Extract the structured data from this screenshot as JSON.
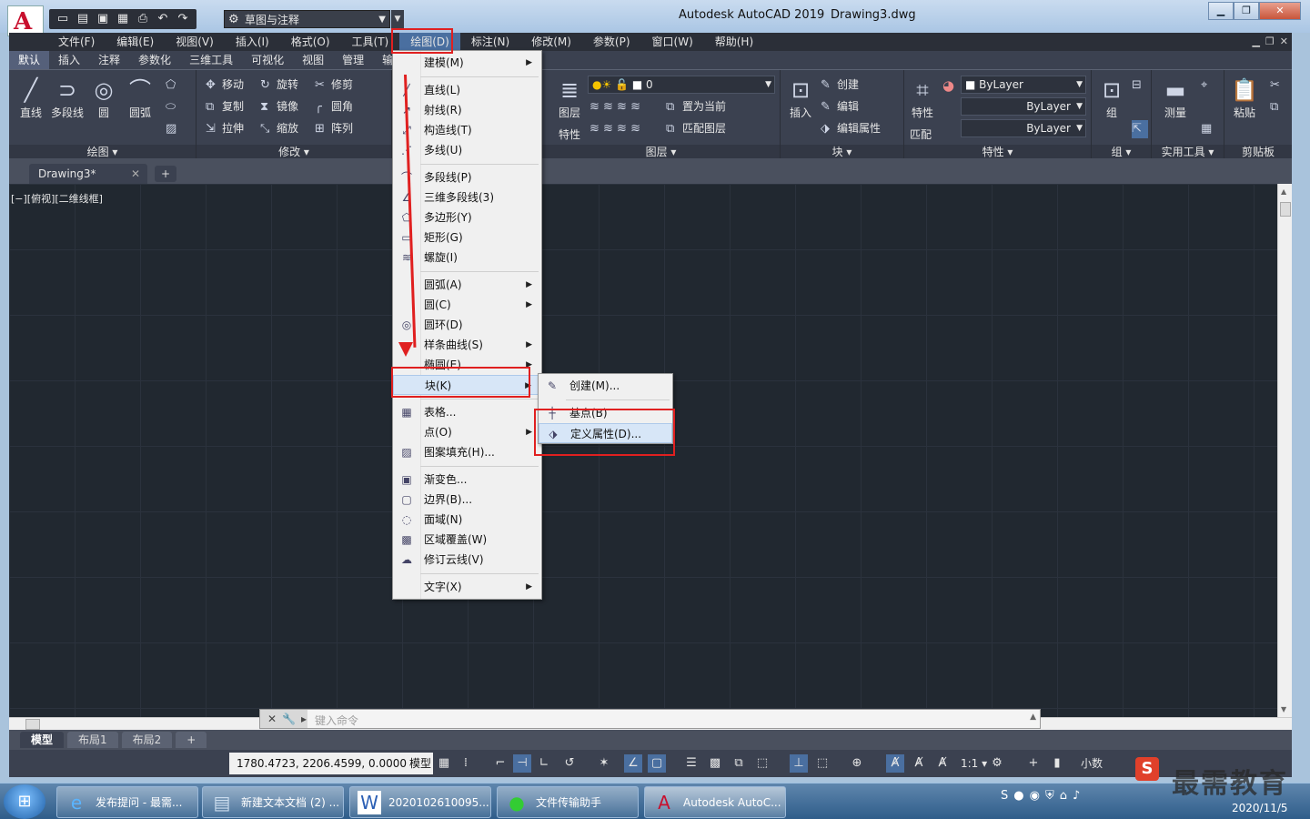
{
  "titlebar": {
    "app_title": "Autodesk AutoCAD 2019",
    "doc_title": "Drawing3.dwg",
    "workspace": "草图与注释",
    "logo_letter": "A"
  },
  "menubar": {
    "items": [
      "文件(F)",
      "编辑(E)",
      "视图(V)",
      "插入(I)",
      "格式(O)",
      "工具(T)",
      "绘图(D)",
      "标注(N)",
      "修改(M)",
      "参数(P)",
      "窗口(W)",
      "帮助(H)"
    ],
    "active_index": 6
  },
  "ribbon_tabs": [
    "默认",
    "插入",
    "注释",
    "参数化",
    "三维工具",
    "可视化",
    "视图",
    "管理",
    "输"
  ],
  "ribbon": {
    "draw_panel": {
      "title": "绘图 ▾",
      "line": "直线",
      "polyline": "多段线",
      "circle": "圆",
      "arc": "圆弧"
    },
    "modify_panel": {
      "title": "修改 ▾",
      "move": "移动",
      "rotate": "旋转",
      "trim": "修剪",
      "copy": "复制",
      "mirror": "镜像",
      "fillet": "圆角",
      "stretch": "拉伸",
      "scale": "缩放",
      "array": "阵列"
    },
    "layers_panel": {
      "title": "图层 ▾",
      "props_top": "图层",
      "props_bottom": "特性",
      "layer_value": "0",
      "set_current": "置为当前",
      "match_layer": "匹配图层"
    },
    "block_panel": {
      "title": "块 ▾",
      "insert": "插入",
      "create": "创建",
      "edit": "编辑",
      "edit_attr": "编辑属性"
    },
    "properties_panel": {
      "title": "特性 ▾",
      "match_top": "特性",
      "match_bottom": "匹配",
      "color": "ByLayer",
      "linetype": "ByLayer",
      "lineweight": "ByLayer"
    },
    "groups_panel": {
      "title": "组 ▾",
      "group": "组"
    },
    "utilities_panel": {
      "title": "实用工具 ▾",
      "measure": "测量"
    },
    "clipboard_panel": {
      "title": "剪贴板",
      "paste": "粘贴"
    }
  },
  "doc_tab": "Drawing3*",
  "viewport_label": "[−][俯视][二维线框]",
  "draw_menu": {
    "items": [
      {
        "label": "建模(M)",
        "icon": "",
        "sub": true
      },
      {
        "label": "直线(L)",
        "icon": "╱",
        "sub": false
      },
      {
        "label": "射线(R)",
        "icon": "↗",
        "sub": false
      },
      {
        "label": "构造线(T)",
        "icon": "⤢",
        "sub": false
      },
      {
        "label": "多线(U)",
        "icon": "⋰",
        "sub": false
      },
      {
        "label": "多段线(P)",
        "icon": "⌒",
        "sub": false
      },
      {
        "label": "三维多段线(3)",
        "icon": "∠",
        "sub": false
      },
      {
        "label": "多边形(Y)",
        "icon": "⬠",
        "sub": false
      },
      {
        "label": "矩形(G)",
        "icon": "▭",
        "sub": false
      },
      {
        "label": "螺旋(I)",
        "icon": "≋",
        "sub": false
      },
      {
        "label": "圆弧(A)",
        "icon": "",
        "sub": true
      },
      {
        "label": "圆(C)",
        "icon": "",
        "sub": true
      },
      {
        "label": "圆环(D)",
        "icon": "◎",
        "sub": false
      },
      {
        "label": "样条曲线(S)",
        "icon": "",
        "sub": true
      },
      {
        "label": "椭圆(E)",
        "icon": "",
        "sub": true
      },
      {
        "label": "块(K)",
        "icon": "",
        "sub": true
      },
      {
        "label": "表格...",
        "icon": "▦",
        "sub": false
      },
      {
        "label": "点(O)",
        "icon": "",
        "sub": true
      },
      {
        "label": "图案填充(H)...",
        "icon": "▨",
        "sub": false
      },
      {
        "label": "渐变色...",
        "icon": "▣",
        "sub": false
      },
      {
        "label": "边界(B)...",
        "icon": "▢",
        "sub": false
      },
      {
        "label": "面域(N)",
        "icon": "◌",
        "sub": false
      },
      {
        "label": "区域覆盖(W)",
        "icon": "▩",
        "sub": false
      },
      {
        "label": "修订云线(V)",
        "icon": "☁",
        "sub": false
      },
      {
        "label": "文字(X)",
        "icon": "",
        "sub": true
      }
    ]
  },
  "block_submenu": {
    "items": [
      {
        "label": "创建(M)...",
        "icon": "✎"
      },
      {
        "label": "基点(B)",
        "icon": "┼"
      },
      {
        "label": "定义属性(D)...",
        "icon": "⬗"
      }
    ]
  },
  "cmdline": {
    "placeholder": "键入命令"
  },
  "layout_tabs": [
    "模型",
    "布局1",
    "布局2"
  ],
  "statusbar": {
    "coords": "1780.4723, 2206.4599, 0.0000",
    "model": "模型",
    "scale": "1:1 ▾",
    "units": "小数"
  },
  "taskbar": {
    "tasks": [
      "发布提问 - 最需...",
      "新建文本文档 (2) ...",
      "2020102610095...",
      "文件传输助手",
      "Autodesk AutoC..."
    ],
    "date": "2020/11/5"
  },
  "watermark": {
    "s": "S",
    "text": "最需教育"
  },
  "colors": {
    "ribbon_bg": "#3b4150",
    "canvas_bg": "#212830",
    "highlight_red": "#e02020",
    "menu_active": "#4a6fa0"
  }
}
